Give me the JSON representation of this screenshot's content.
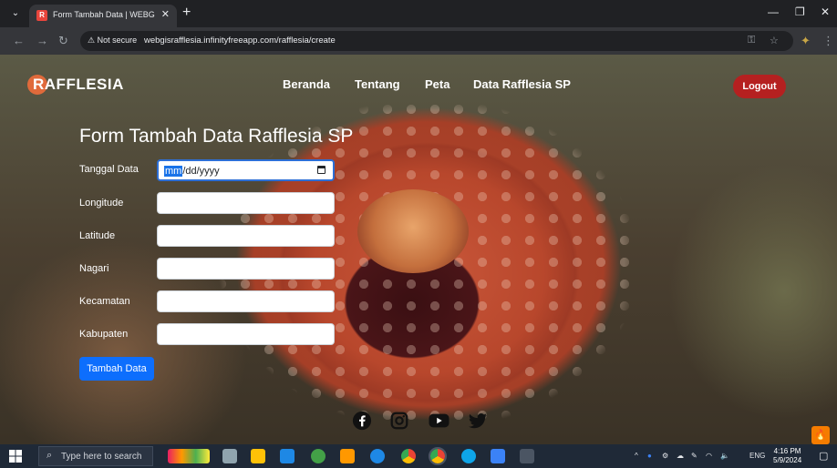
{
  "browser": {
    "tab_title": "Form Tambah Data | WEBGIS R...",
    "security_label": "Not secure",
    "url": "webgisrafflesia.infinityfreeapp.com/rafflesia/create"
  },
  "site": {
    "brand": "RAFFLESIA",
    "nav": [
      "Beranda",
      "Tentang",
      "Peta",
      "Data Rafflesia SP"
    ],
    "logout_label": "Logout"
  },
  "form": {
    "title": "Form Tambah Data Rafflesia SP",
    "fields": [
      {
        "label": "Tanggal Data",
        "value_selected": "mm",
        "value_rest": "/dd/yyyy"
      },
      {
        "label": "Longitude",
        "value": ""
      },
      {
        "label": "Latitude",
        "value": ""
      },
      {
        "label": "Nagari",
        "value": ""
      },
      {
        "label": "Kecamatan",
        "value": ""
      },
      {
        "label": "Kabupaten",
        "value": ""
      }
    ],
    "submit_label": "Tambah Data"
  },
  "social_icons": [
    "facebook-icon",
    "instagram-icon",
    "youtube-icon",
    "twitter-icon"
  ],
  "taskbar": {
    "search_placeholder": "Type here to search",
    "lang": "ENG",
    "time": "4:16 PM",
    "date": "5/9/2024"
  },
  "colors": {
    "primary_button": "#0d6efd",
    "logout_button": "#b52020"
  }
}
